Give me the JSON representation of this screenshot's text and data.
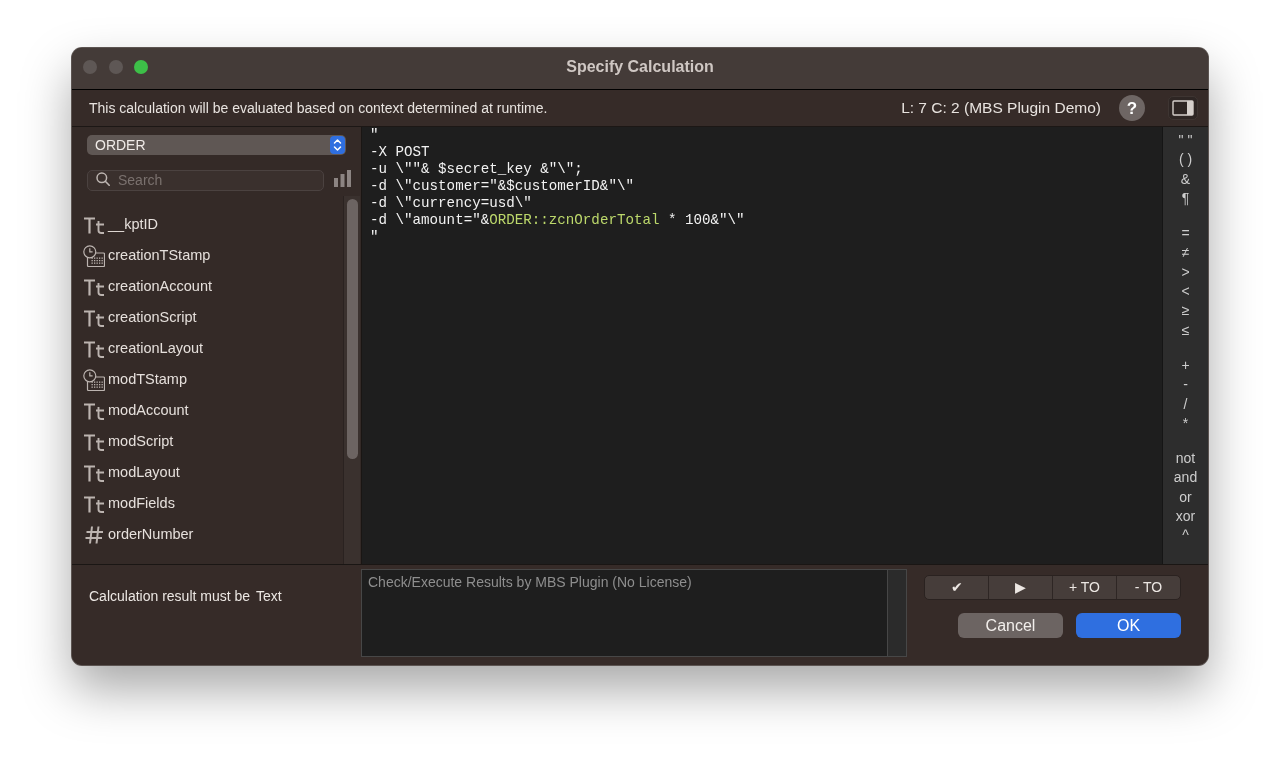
{
  "window": {
    "title": "Specify Calculation",
    "controls": [
      {
        "kind": "close",
        "disabled": true
      },
      {
        "kind": "minimize",
        "disabled": true
      },
      {
        "kind": "zoom",
        "disabled": false
      }
    ]
  },
  "info_bar": {
    "message": "This calculation will be evaluated based on context determined at runtime.",
    "cursor_position": "L: 7 C: 2 (MBS Plugin Demo)",
    "help_button": "?"
  },
  "sidebar": {
    "table_dropdown": "ORDER",
    "search": {
      "placeholder": "Search"
    },
    "fields": [
      {
        "name": "__kptID",
        "kind": "text"
      },
      {
        "name": "creationTStamp",
        "kind": "timestamp"
      },
      {
        "name": "creationAccount",
        "kind": "text"
      },
      {
        "name": "creationScript",
        "kind": "text"
      },
      {
        "name": "creationLayout",
        "kind": "text"
      },
      {
        "name": "modTStamp",
        "kind": "timestamp"
      },
      {
        "name": "modAccount",
        "kind": "text"
      },
      {
        "name": "modScript",
        "kind": "text"
      },
      {
        "name": "modLayout",
        "kind": "text"
      },
      {
        "name": "modFields",
        "kind": "text"
      },
      {
        "name": "orderNumber",
        "kind": "number"
      }
    ]
  },
  "editor": {
    "lines": [
      {
        "segments": [
          {
            "text": "\"",
            "kind": "plain"
          }
        ]
      },
      {
        "segments": [
          {
            "text": "-X POST",
            "kind": "plain"
          }
        ]
      },
      {
        "segments": [
          {
            "text": "-u \\\"\"& $secret_key &\"\\\";",
            "kind": "plain"
          }
        ]
      },
      {
        "segments": [
          {
            "text": "-d \\\"customer=\"&$customerID&\"\\\"",
            "kind": "plain"
          }
        ]
      },
      {
        "segments": [
          {
            "text": "-d \\\"currency=usd\\\"",
            "kind": "plain"
          }
        ]
      },
      {
        "segments": [
          {
            "text": "-d \\\"amount=\"&",
            "kind": "plain"
          },
          {
            "text": "ORDER::zcnOrderTotal",
            "kind": "field"
          },
          {
            "text": " * 100&\"\\\"",
            "kind": "plain"
          }
        ]
      },
      {
        "segments": [
          {
            "text": "\"",
            "kind": "plain"
          }
        ]
      }
    ]
  },
  "operators": [
    [
      "\" \"",
      "( )",
      "&",
      "¶"
    ],
    [
      "=",
      "≠",
      ">",
      "<",
      "≥",
      "≤"
    ],
    [
      "+",
      "-",
      "/",
      "*"
    ],
    [
      "not",
      "and",
      "or",
      "xor",
      "^"
    ]
  ],
  "footer": {
    "result_label": "Calculation result must be",
    "result_type": "Text",
    "results": {
      "placeholder": "Check/Execute Results by MBS Plugin (No License)"
    },
    "tools": [
      "✔",
      "▶",
      "+ TO",
      "- TO"
    ],
    "buttons": [
      {
        "label": "Cancel",
        "default": false
      },
      {
        "label": "OK",
        "default": true
      }
    ]
  }
}
